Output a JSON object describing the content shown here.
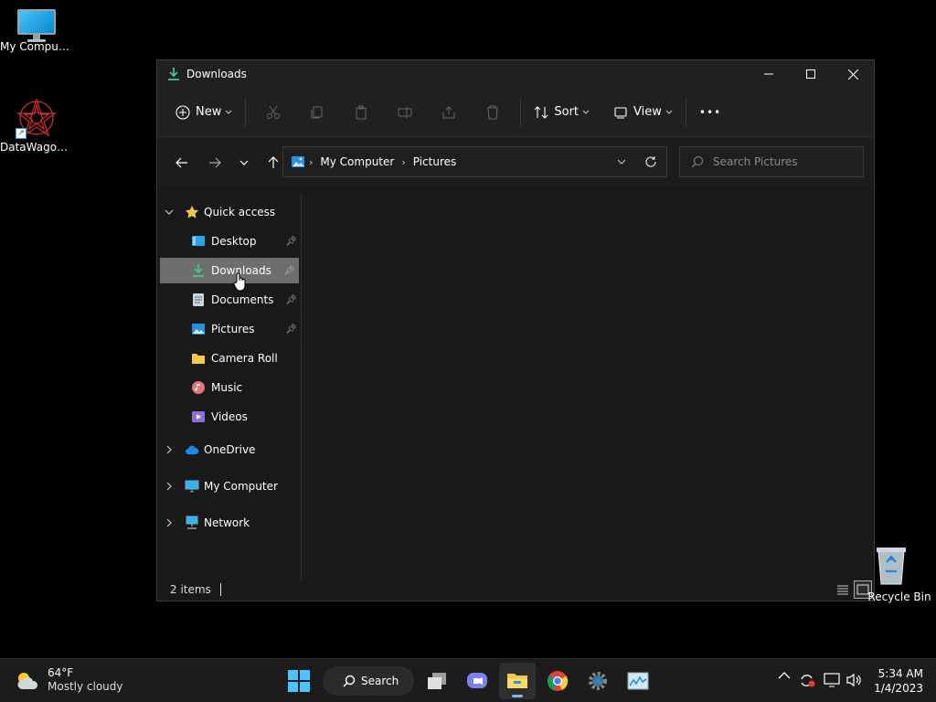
{
  "desktop": {
    "icons": [
      {
        "label": "My Computer"
      },
      {
        "label": "DataWagon..."
      },
      {
        "label": "Recycle Bin"
      }
    ]
  },
  "window": {
    "title": "Downloads",
    "controls": {
      "minimize": "—",
      "maximize": "☐",
      "close": "✕"
    },
    "toolbar": {
      "new_label": "New",
      "sort_label": "Sort",
      "view_label": "View",
      "more_label": "•••"
    },
    "address": {
      "crumbs": [
        "My Computer",
        "Pictures"
      ]
    },
    "search": {
      "placeholder": "Search Pictures"
    },
    "sidebar": {
      "quick_access": "Quick access",
      "items": [
        {
          "label": "Desktop",
          "pinned": true
        },
        {
          "label": "Downloads",
          "pinned": true,
          "selected": true
        },
        {
          "label": "Documents",
          "pinned": true
        },
        {
          "label": "Pictures",
          "pinned": true
        },
        {
          "label": "Camera Roll",
          "pinned": false
        },
        {
          "label": "Music",
          "pinned": false
        },
        {
          "label": "Videos",
          "pinned": false
        }
      ],
      "roots": [
        {
          "label": "OneDrive"
        },
        {
          "label": "My Computer"
        },
        {
          "label": "Network"
        }
      ]
    },
    "status": {
      "items": "2 items"
    }
  },
  "taskbar": {
    "weather": {
      "temp": "64°F",
      "condition": "Mostly cloudy"
    },
    "search_label": "Search",
    "clock": {
      "time": "5:34 AM",
      "date": "1/4/2023"
    }
  },
  "colors": {
    "accent": "#0078d4",
    "download_green": "#3cc98a",
    "folder_yellow": "#f4c84a",
    "selected_bg": "#6e6e6e"
  }
}
